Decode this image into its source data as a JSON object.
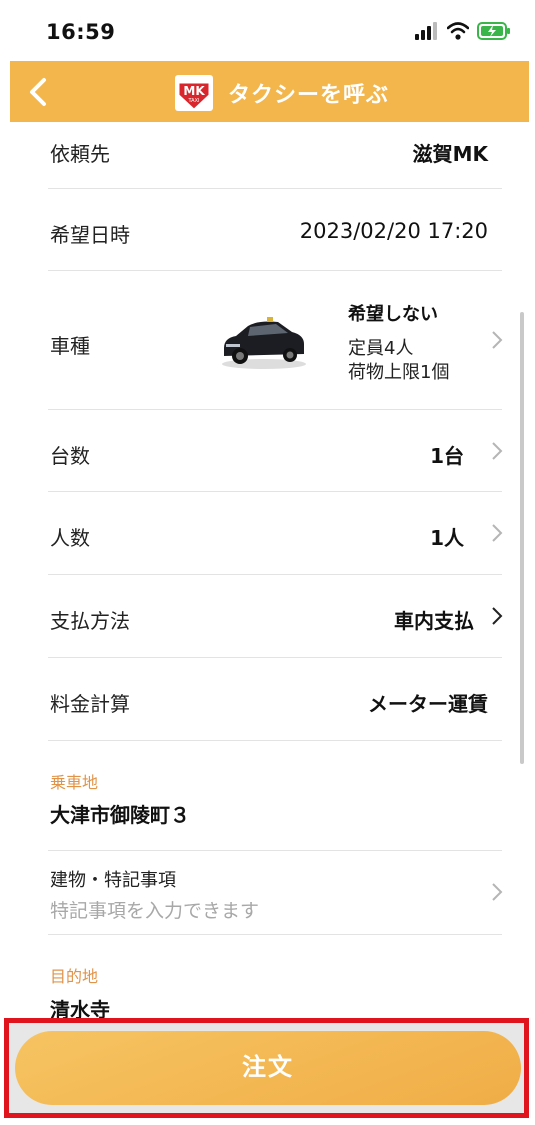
{
  "status_bar": {
    "time": "16:59"
  },
  "header": {
    "title": "タクシーを呼ぶ",
    "logo_text": "MK",
    "logo_sub": "TAXI",
    "brand_color": "#f2b64d"
  },
  "rows": {
    "requestee": {
      "label": "依頼先",
      "value": "滋賀MK"
    },
    "datetime": {
      "label": "希望日時",
      "value": "2023/02/20 17:20"
    },
    "car_type": {
      "label": "車種",
      "value": "希望しない",
      "capacity": "定員4人",
      "luggage": "荷物上限1個"
    },
    "cars": {
      "label": "台数",
      "value": "1台"
    },
    "people": {
      "label": "人数",
      "value": "1人"
    },
    "payment": {
      "label": "支払方法",
      "value": "車内支払"
    },
    "fare": {
      "label": "料金計算",
      "value": "メーター運賃"
    }
  },
  "pickup": {
    "label": "乗車地",
    "value": "大津市御陵町３"
  },
  "notes": {
    "label": "建物・特記事項",
    "placeholder": "特記事項を入力できます"
  },
  "destination": {
    "label": "目的地",
    "value": "清水寺"
  },
  "order_button": {
    "label": "注文"
  },
  "colors": {
    "accent": "#f2b64d",
    "section_label": "#e0944a",
    "highlight_border": "#e0141c"
  }
}
